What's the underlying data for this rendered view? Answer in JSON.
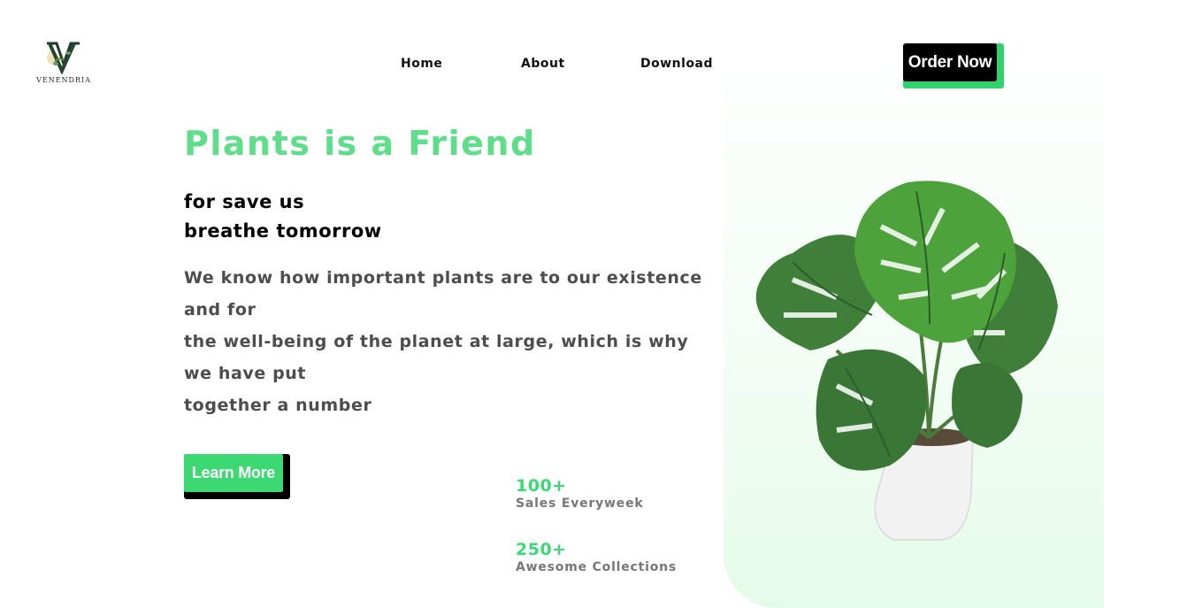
{
  "brand": {
    "name": "VENENDRIA",
    "logo_icon": "venendria-logo-icon"
  },
  "nav": {
    "items": [
      "Home",
      "About",
      "Download"
    ]
  },
  "header": {
    "cta_label": "Order Now"
  },
  "hero": {
    "title": "Plants is a Friend",
    "subtitle_lines": [
      "for save us",
      "breathe tomorrow"
    ],
    "description_lines": [
      "We know how important plants are to our existence",
      "and for",
      "the well-being of the planet at large, which is why",
      "we have put",
      "together a number"
    ],
    "cta_label": "Learn More",
    "image": "monstera-plant-image"
  },
  "stats": [
    {
      "value": "100+",
      "label": "Sales Everyweek"
    },
    {
      "value": "250+",
      "label": "Awesome Collections"
    }
  ],
  "colors": {
    "accent": "#3cd872",
    "title": "#5fde8a",
    "dark": "#000000",
    "text": "#4d4d4d"
  }
}
